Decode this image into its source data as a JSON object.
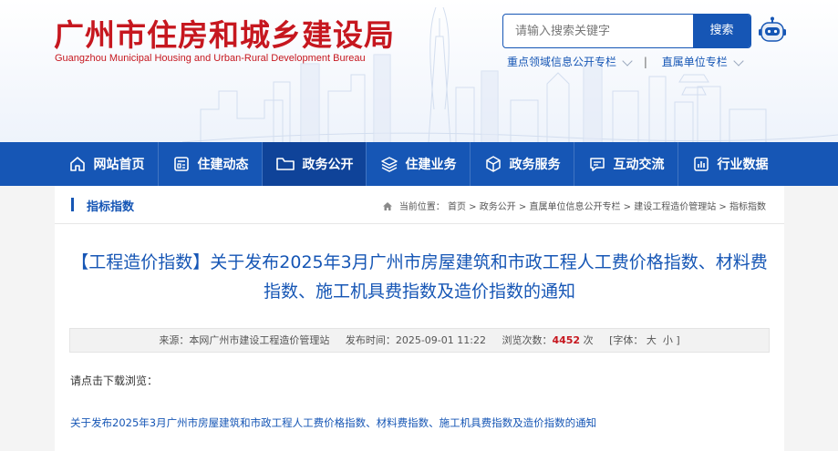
{
  "site": {
    "name_cn": "广州市住房和城乡建设局",
    "name_en": "Guangzhou Municipal Housing and Urban-Rural Development Bureau"
  },
  "search": {
    "placeholder": "请输入搜索关键字",
    "button_label": "搜索"
  },
  "quick_links": [
    {
      "label": "重点领域信息公开专栏"
    },
    {
      "label": "直属单位专栏"
    }
  ],
  "quick_links_separator": "|",
  "nav": [
    {
      "label": "网站首页",
      "icon": "home-icon"
    },
    {
      "label": "住建动态",
      "icon": "news-icon"
    },
    {
      "label": "政务公开",
      "icon": "folder-icon",
      "active": true
    },
    {
      "label": "住建业务",
      "icon": "layers-icon"
    },
    {
      "label": "政务服务",
      "icon": "cube-icon"
    },
    {
      "label": "互动交流",
      "icon": "chat-icon"
    },
    {
      "label": "行业数据",
      "icon": "bar-chart-icon"
    }
  ],
  "section": {
    "title": "指标指数"
  },
  "breadcrumb": {
    "prefix": "当前位置：",
    "items": [
      "首页",
      "政务公开",
      "直属单位信息公开专栏",
      "建设工程造价管理站",
      "指标指数"
    ],
    "separator": " > "
  },
  "article": {
    "title": "【工程造价指数】关于发布2025年3月广州市房屋建筑和市政工程人工费价格指数、材料费指数、施工机具费指数及造价指数的通知",
    "meta": {
      "source_label": "来源：",
      "source": "本网广州市建设工程造价管理站",
      "date_label": "发布时间：",
      "date": "2025-09-01 11:22",
      "views_label": "浏览次数：",
      "views": "4452",
      "views_unit": "次",
      "font_label": "[字体：",
      "font_large": "大",
      "font_small": "小",
      "font_close": "]"
    },
    "intro": "请点击下载浏览：",
    "attachment": "关于发布2025年3月广州市房屋建筑和市政工程人工费价格指数、材料费指数、施工机具费指数及造价指数的通知"
  },
  "colors": {
    "brand_red": "#c6171f",
    "primary_blue": "#1656b5",
    "nav_active": "#0f4399"
  }
}
